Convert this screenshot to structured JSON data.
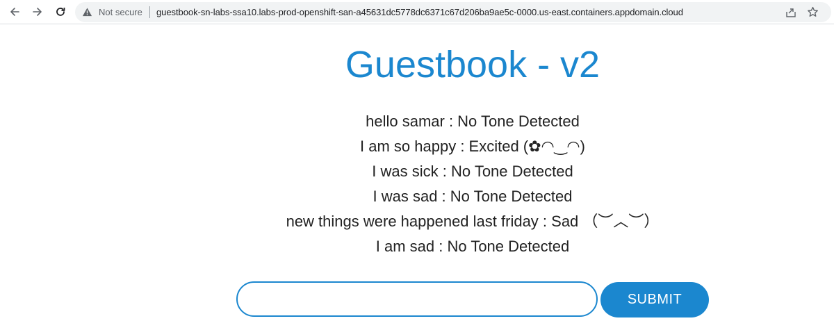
{
  "browser": {
    "security_label": "Not secure",
    "url": "guestbook-sn-labs-ssa10.labs-prod-openshift-san-a45631dc5778dc6371c67d206ba9ae5c-0000.us-east.containers.appdomain.cloud",
    "icons": [
      "back-arrow-icon",
      "forward-arrow-icon",
      "reload-icon",
      "warning-icon",
      "share-icon",
      "star-icon"
    ]
  },
  "page": {
    "title": "Guestbook - v2",
    "entries": [
      "hello samar : No Tone Detected",
      "I am so happy : Excited (✿◠‿◠)",
      "I was sick : No Tone Detected",
      "I was sad : No Tone Detected",
      "new things were happened last friday : Sad （︶︿︶）",
      "I am sad : No Tone Detected"
    ],
    "form": {
      "input_value": "",
      "input_placeholder": "",
      "submit_label": "SUBMIT"
    }
  },
  "colors": {
    "accent": "#1b87cf",
    "text": "#222222",
    "omnibox_bg": "#f1f3f4"
  }
}
